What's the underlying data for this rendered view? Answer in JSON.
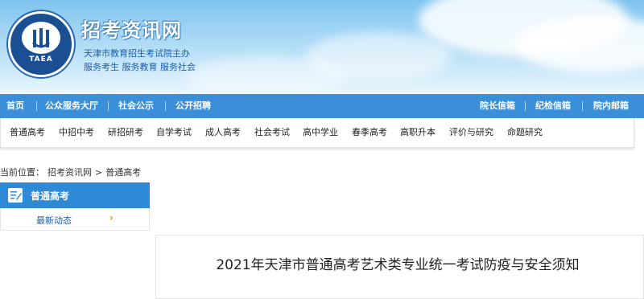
{
  "header": {
    "site_title": "招考资讯网",
    "logo_text": "TAEA",
    "sub_line1": "天津市教育招生考试院主办",
    "sub_line2": "服务考生 服务教育 服务社会"
  },
  "topnav": {
    "left": [
      "首页",
      "公众服务大厅",
      "社会公示",
      "公开招聘"
    ],
    "right": [
      "院长信箱",
      "纪检信箱",
      "院内邮箱"
    ]
  },
  "subnav": {
    "items": [
      "普通高考",
      "中招中考",
      "研招研考",
      "自学考试",
      "成人高考",
      "社会考试",
      "高中学业",
      "春季高考",
      "高职升本",
      "评价与研究",
      "命题研究"
    ]
  },
  "breadcrumb": {
    "prefix": "当前位置：",
    "home": "招考资讯网",
    "sep": ">",
    "current": "普通高考"
  },
  "sidebar": {
    "title": "普通高考",
    "item": "最新动态",
    "arrow": "›"
  },
  "article": {
    "title": "2021年天津市普通高考艺术类专业统一考试防疫与安全须知"
  },
  "colors": {
    "nav_blue": "#3b8fd9",
    "side_blue": "#2e8ad6",
    "arrow_orange": "#f08a1c"
  }
}
